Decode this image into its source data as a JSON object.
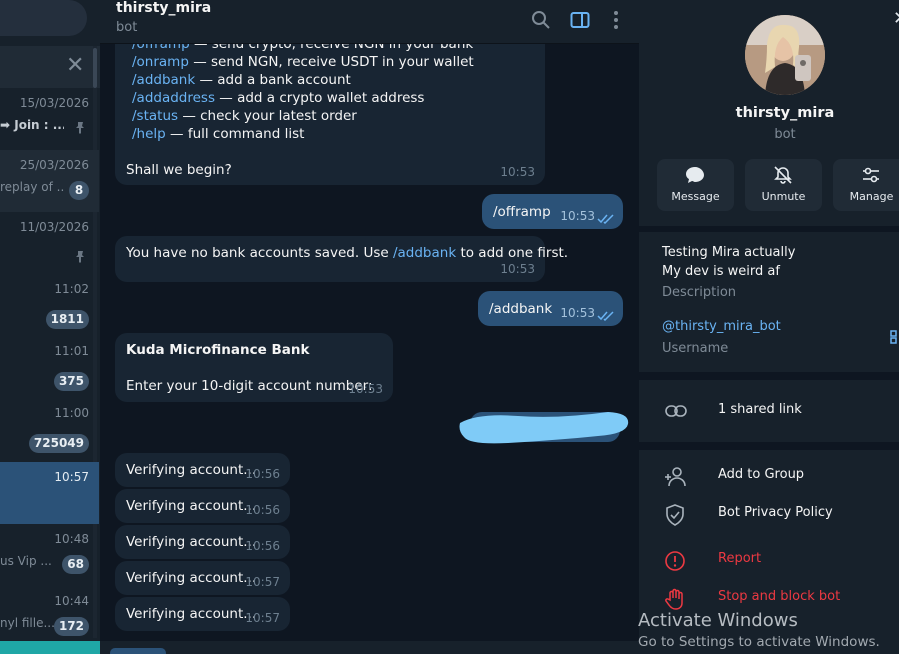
{
  "chat_list": {
    "rows": [
      {
        "date": "15/03/2026",
        "preview_prefix": "➡ Join : ...",
        "pinned": true,
        "badge": ""
      },
      {
        "date": "25/03/2026",
        "preview_prefix": "replay of ...",
        "pinned": false,
        "badge": "8"
      },
      {
        "date": "11/03/2026",
        "preview_prefix": "",
        "pinned": true,
        "badge": ""
      },
      {
        "date": "11:02",
        "preview_prefix": "",
        "pinned": false,
        "badge": "1811"
      },
      {
        "date": "11:01",
        "preview_prefix": "",
        "pinned": false,
        "badge": "375"
      },
      {
        "date": "11:00",
        "preview_prefix": "",
        "pinned": false,
        "badge": "725049"
      },
      {
        "date": "10:57",
        "preview_prefix": "",
        "pinned": false,
        "badge": ""
      },
      {
        "date": "10:48",
        "preview_prefix": "us Vip ...",
        "pinned": false,
        "badge": "68"
      },
      {
        "date": "10:44",
        "preview_prefix": "nyl fille...",
        "pinned": false,
        "badge": "172"
      }
    ]
  },
  "chat": {
    "title": "thirsty_mira",
    "subtitle": "bot",
    "intro": {
      "lines": [
        {
          "cmd": "/offramp",
          "text": " — send crypto, receive NGN in your bank"
        },
        {
          "cmd": "/onramp",
          "text": " — send NGN, receive USDT in your wallet"
        },
        {
          "cmd": "/addbank",
          "text": " — add a bank account"
        },
        {
          "cmd": "/addaddress",
          "text": " — add a crypto wallet address"
        },
        {
          "cmd": "/status",
          "text": " — check your latest order"
        },
        {
          "cmd": "/help",
          "text": " — full command list"
        }
      ],
      "closing": "Shall we begin?",
      "time": "10:53"
    },
    "out1": {
      "text": "/offramp",
      "time": "10:53"
    },
    "in1": {
      "pre": "You have no bank accounts saved. Use ",
      "cmd": "/addbank",
      "post": " to add one first.",
      "time": "10:53"
    },
    "out2": {
      "text": "/addbank",
      "time": "10:53"
    },
    "in2": {
      "title": "Kuda Microfinance Bank",
      "body": "Enter your 10-digit account number:",
      "time": "10:53"
    },
    "verifying": [
      {
        "text": "Verifying account...",
        "time": "10:56"
      },
      {
        "text": "Verifying account...",
        "time": "10:56"
      },
      {
        "text": "Verifying account...",
        "time": "10:56"
      },
      {
        "text": "Verifying account...",
        "time": "10:57"
      },
      {
        "text": "Verifying account...",
        "time": "10:57"
      }
    ]
  },
  "profile": {
    "name": "thirsty_mira",
    "subtitle": "bot",
    "actions": [
      {
        "label": "Message",
        "icon": "message-icon"
      },
      {
        "label": "Unmute",
        "icon": "bell-off-icon"
      },
      {
        "label": "Manage",
        "icon": "sliders-icon"
      }
    ],
    "description_lines": [
      "Testing Mira actually",
      "My dev is weird af"
    ],
    "description_label": "Description",
    "username": "@thirsty_mira_bot",
    "username_label": "Username",
    "shared_links": "1 shared link",
    "menu": [
      {
        "label": "Add to Group",
        "icon": "add-user-icon",
        "danger": false
      },
      {
        "label": "Bot Privacy Policy",
        "icon": "shield-check-icon",
        "danger": false
      },
      {
        "label": "Report",
        "icon": "alert-icon",
        "danger": true
      },
      {
        "label": "Stop and block bot",
        "icon": "hand-icon",
        "danger": true
      }
    ]
  },
  "watermark": {
    "title": "Activate Windows",
    "subtitle": "Go to Settings to activate Windows."
  },
  "colors": {
    "accent": "#6ab3f3",
    "outgoing_bubble": "#2b5278",
    "incoming_bubble": "#182533",
    "danger": "#ec3942"
  }
}
